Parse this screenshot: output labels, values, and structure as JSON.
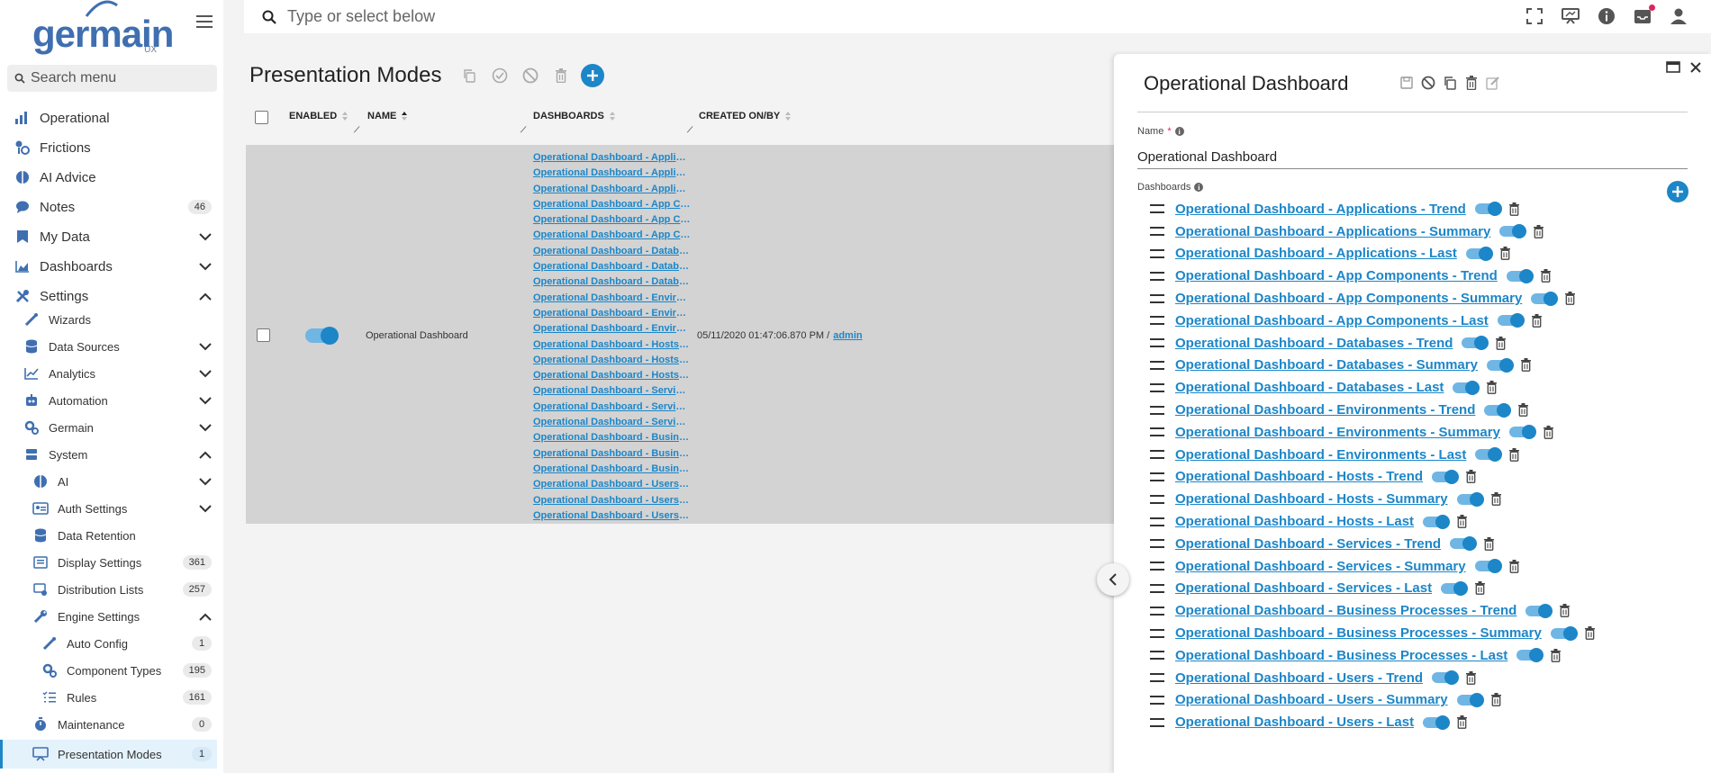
{
  "brand": {
    "name": "germain",
    "sub": "UX"
  },
  "menu_search": {
    "placeholder": "Search menu"
  },
  "topbar": {
    "search_placeholder": "Type or select below"
  },
  "sidebar": {
    "items": [
      {
        "label": "Operational",
        "icon": "speed-icon"
      },
      {
        "label": "Frictions",
        "icon": "friction-icon"
      },
      {
        "label": "AI Advice",
        "icon": "brain-icon"
      },
      {
        "label": "Notes",
        "icon": "chat-bubble-icon",
        "badge": "46"
      },
      {
        "label": "My Data",
        "icon": "bookmark-icon"
      },
      {
        "label": "Dashboards",
        "icon": "area-chart-icon"
      },
      {
        "label": "Settings",
        "icon": "tools-icon"
      },
      {
        "label": "Wizards",
        "icon": "wand-icon"
      },
      {
        "label": "Data Sources",
        "icon": "database-icon"
      },
      {
        "label": "Analytics",
        "icon": "line-chart-icon"
      },
      {
        "label": "Automation",
        "icon": "robot-icon"
      },
      {
        "label": "Germain",
        "icon": "gears-icon"
      },
      {
        "label": "System",
        "icon": "server-icon"
      },
      {
        "label": "AI",
        "icon": "brain-icon"
      },
      {
        "label": "Auth Settings",
        "icon": "id-card-icon"
      },
      {
        "label": "Data Retention",
        "icon": "database-icon"
      },
      {
        "label": "Display Settings",
        "icon": "list-box-icon",
        "badge": "361"
      },
      {
        "label": "Distribution Lists",
        "icon": "distribution-icon",
        "badge": "257"
      },
      {
        "label": "Engine Settings",
        "icon": "wrench-icon"
      },
      {
        "label": "Auto Config",
        "icon": "wand-icon",
        "badge": "1"
      },
      {
        "label": "Component Types",
        "icon": "gears-icon",
        "badge": "195"
      },
      {
        "label": "Rules",
        "icon": "list-check-icon",
        "badge": "161"
      },
      {
        "label": "Maintenance",
        "icon": "stopwatch-icon",
        "badge": "0"
      },
      {
        "label": "Presentation Modes",
        "icon": "presentation-icon",
        "badge": "1"
      }
    ]
  },
  "main": {
    "title": "Presentation Modes",
    "columns": {
      "enabled": "ENABLED",
      "name": "NAME",
      "dashboards": "DASHBOARDS",
      "created": "CREATED ON/BY"
    },
    "row": {
      "name": "Operational Dashboard",
      "created_on": "05/11/2020 01:47:06.870 PM /",
      "created_by": "admin",
      "dashboards": [
        "Operational Dashboard - Applications - Trend",
        "Operational Dashboard - Applications - Summary",
        "Operational Dashboard - Applications - Last",
        "Operational Dashboard - App Components - Trend",
        "Operational Dashboard - App Components - Summary",
        "Operational Dashboard - App Components - Last",
        "Operational Dashboard - Databases - Trend",
        "Operational Dashboard - Databases - Summary",
        "Operational Dashboard - Databases - Last",
        "Operational Dashboard - Environments - Trend",
        "Operational Dashboard - Environments - Summary",
        "Operational Dashboard - Environments - Last",
        "Operational Dashboard - Hosts - Trend",
        "Operational Dashboard - Hosts - Summary",
        "Operational Dashboard - Hosts - Last",
        "Operational Dashboard - Services - Trend",
        "Operational Dashboard - Services - Summary",
        "Operational Dashboard - Services - Last",
        "Operational Dashboard - Business Processes - Trend",
        "Operational Dashboard - Business Processes - Summary",
        "Operational Dashboard - Business Processes - Last",
        "Operational Dashboard - Users - Trend",
        "Operational Dashboard - Users - Summary",
        "Operational Dashboard - Users - Last"
      ]
    }
  },
  "panel": {
    "title": "Operational Dashboard",
    "name_label": "Name",
    "name_required": "*",
    "name_value": "Operational Dashboard",
    "dashboards_label": "Dashboards",
    "dashboards": [
      "Operational Dashboard - Applications - Trend",
      "Operational Dashboard - Applications - Summary",
      "Operational Dashboard - Applications - Last",
      "Operational Dashboard - App Components - Trend",
      "Operational Dashboard - App Components - Summary",
      "Operational Dashboard - App Components - Last",
      "Operational Dashboard - Databases - Trend",
      "Operational Dashboard - Databases - Summary",
      "Operational Dashboard - Databases - Last",
      "Operational Dashboard - Environments - Trend",
      "Operational Dashboard - Environments - Summary",
      "Operational Dashboard - Environments - Last",
      "Operational Dashboard - Hosts - Trend",
      "Operational Dashboard - Hosts - Summary",
      "Operational Dashboard - Hosts - Last",
      "Operational Dashboard - Services - Trend",
      "Operational Dashboard - Services - Summary",
      "Operational Dashboard - Services - Last",
      "Operational Dashboard - Business Processes - Trend",
      "Operational Dashboard - Business Processes - Summary",
      "Operational Dashboard - Business Processes - Last",
      "Operational Dashboard - Users - Trend",
      "Operational Dashboard - Users - Summary",
      "Operational Dashboard - Users - Last"
    ]
  },
  "colors": {
    "accent": "#1c86c8",
    "brand": "#3f6fb0",
    "row_selected": "#d3d3d3",
    "notification": "#e0245e"
  }
}
